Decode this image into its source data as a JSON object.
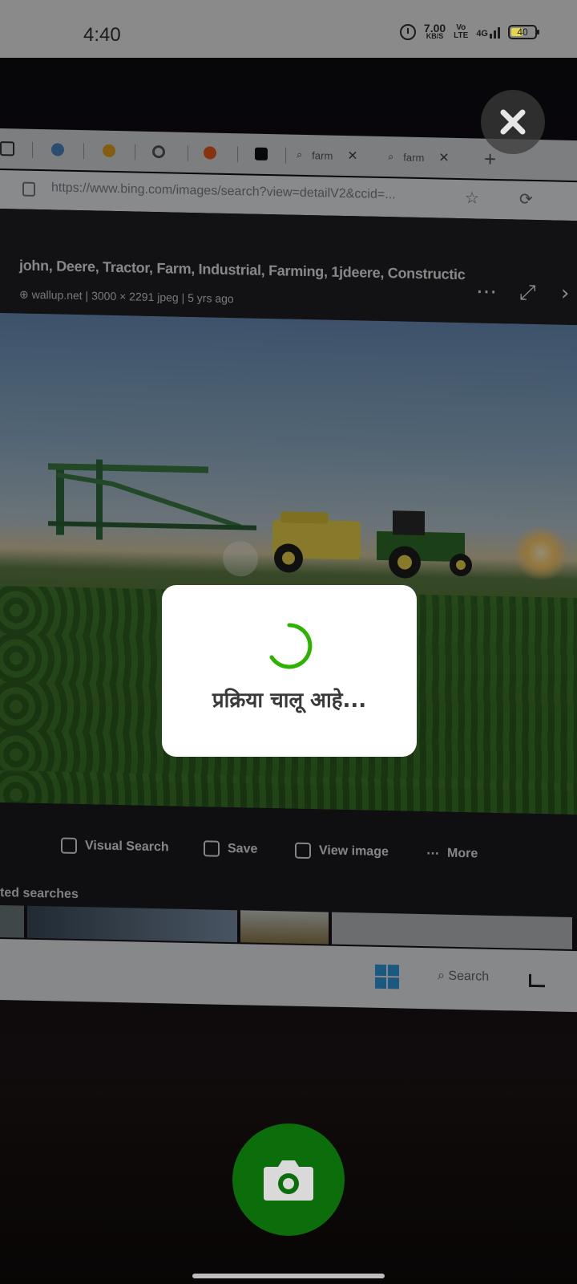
{
  "status_bar": {
    "time": "4:40",
    "network_speed_value": "7.00",
    "network_speed_unit": "KB/S",
    "volte_line1": "Vo",
    "volte_line2": "LTE",
    "network_type": "4G",
    "battery_level": "40"
  },
  "viewfinder": {
    "tabs": [
      "farm",
      "farm"
    ],
    "url": "https://www.bing.com/images/search?view=detailV2&ccid=...",
    "image_title": "john, Deere, Tractor, Farm, Industrial, Farming, 1jdeere, Constructic",
    "image_meta": "wallup.net  |  3000 × 2291 jpeg  |  5 yrs ago",
    "actions": {
      "visual_search": "Visual Search",
      "save": "Save",
      "view_image": "View image",
      "more": "More"
    },
    "related_searches_fragment": "ted searches",
    "taskbar_search": "Search"
  },
  "dialog": {
    "message": "प्रक्रिया चालू आहे...",
    "spinner_color": "#2db200"
  },
  "colors": {
    "capture_button": "#0b6e0b",
    "close_button_bg": "#3c3c3c"
  },
  "icons": {
    "close": "close-icon",
    "capture": "camera-icon",
    "alarm": "alarm-icon"
  }
}
